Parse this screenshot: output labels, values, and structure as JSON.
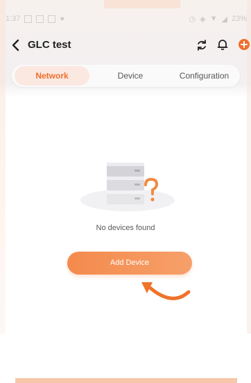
{
  "status_bar": {
    "time": "1:37",
    "battery": "23%"
  },
  "header": {
    "title": "GLC test"
  },
  "tabs": [
    {
      "label": "Network",
      "selected": true
    },
    {
      "label": "Device",
      "selected": false
    },
    {
      "label": "Configuration",
      "selected": false
    }
  ],
  "empty_state": {
    "message": "No devices found"
  },
  "actions": {
    "add_device_label": "Add Device"
  },
  "colors": {
    "accent": "#ee6f2c",
    "accent_light": "#f6a06a",
    "tab_active_bg": "#fbe8e0"
  },
  "icons": [
    "back-chevron-icon",
    "refresh-icon",
    "bell-icon",
    "add-circle-icon",
    "server-stack-question-icon",
    "curved-arrow-icon"
  ]
}
